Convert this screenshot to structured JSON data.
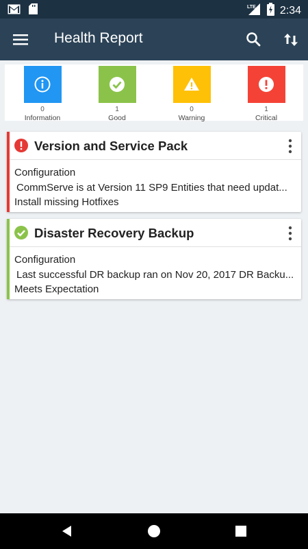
{
  "status_bar": {
    "time": "2:34",
    "network": "LTE"
  },
  "app_bar": {
    "title": "Health Report"
  },
  "summary": [
    {
      "key": "information",
      "count": "0",
      "label": "Information",
      "color": "#2196f3",
      "icon": "info-icon"
    },
    {
      "key": "good",
      "count": "1",
      "label": "Good",
      "color": "#8bc34a",
      "icon": "check-icon"
    },
    {
      "key": "warning",
      "count": "0",
      "label": "Warning",
      "color": "#ffc107",
      "icon": "warning-icon"
    },
    {
      "key": "critical",
      "count": "1",
      "label": "Critical",
      "color": "#f44336",
      "icon": "critical-icon"
    }
  ],
  "cards": [
    {
      "title": "Version and Service Pack",
      "category": "Configuration",
      "detail": "CommServe is at Version 11 SP9 Entities that need updat...",
      "recommendation": "Install missing Hotfixes",
      "status": "critical",
      "accent": "#e53935"
    },
    {
      "title": "Disaster Recovery Backup",
      "category": "Configuration",
      "detail": "Last successful DR backup ran on Nov 20, 2017 DR Backu...",
      "recommendation": "Meets Expectation",
      "status": "good",
      "accent": "#8bc34a"
    }
  ]
}
